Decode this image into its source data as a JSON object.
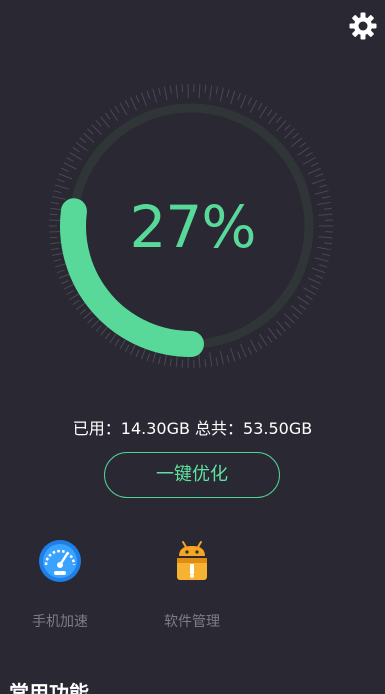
{
  "header": {
    "settings_icon": "gear-icon"
  },
  "memory": {
    "percent_text": "27%",
    "used_fraction": 0.27,
    "usage_text": "已用：14.30GB 总共：53.50GB",
    "colors": {
      "accent": "#58d99a",
      "background": "#2a2832",
      "track": "#3c4a46"
    }
  },
  "actions": {
    "optimize_label": "一键优化"
  },
  "features": [
    {
      "label": "手机加速",
      "icon": "speedometer-icon"
    },
    {
      "label": "软件管理",
      "icon": "android-package-icon"
    }
  ],
  "section": {
    "title": "常用功能"
  }
}
